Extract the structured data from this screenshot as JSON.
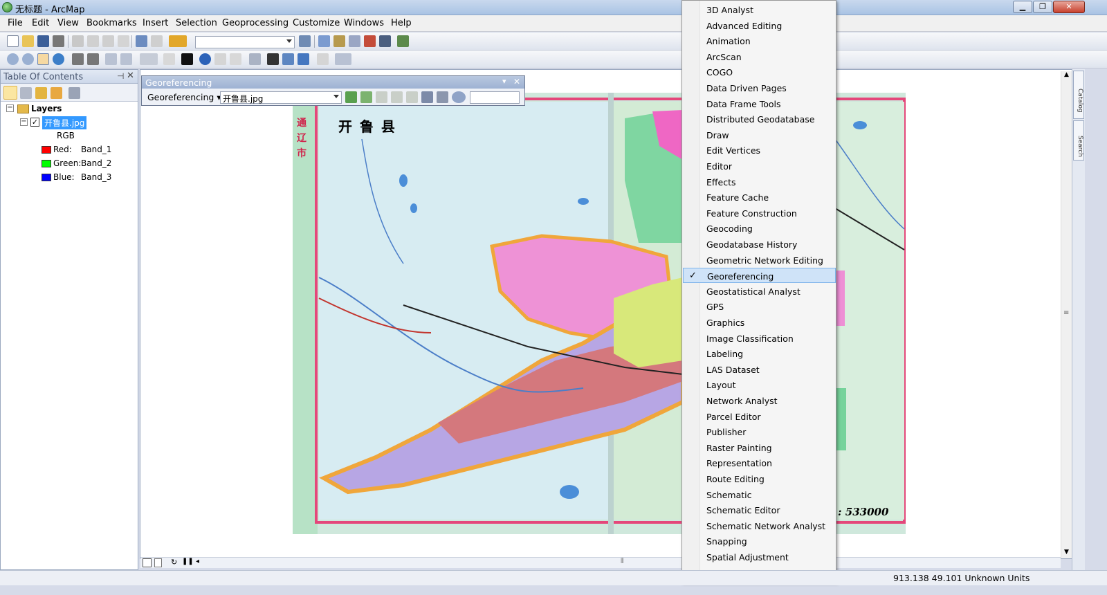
{
  "window": {
    "title": "无标题 - ArcMap"
  },
  "menubar": [
    "File",
    "Edit",
    "View",
    "Bookmarks",
    "Insert",
    "Selection",
    "Geoprocessing",
    "Customize",
    "Windows",
    "Help"
  ],
  "toc": {
    "title": "Table Of Contents",
    "root": "Layers",
    "layer": "开鲁县.jpg",
    "rgb": "RGB",
    "bands": [
      {
        "name": "Red:",
        "band": "Band_1",
        "color": "#ff0000"
      },
      {
        "name": "Green:",
        "band": "Band_2",
        "color": "#00ff00"
      },
      {
        "name": "Blue:",
        "band": "Band_3",
        "color": "#0000ff"
      }
    ]
  },
  "georef": {
    "title": "Georeferencing",
    "menu_label": "Georeferencing",
    "layer_value": "开鲁县.jpg"
  },
  "map": {
    "title_text": "开 鲁 县",
    "scale_text": ": 533000",
    "side_labels": [
      "通",
      "辽",
      "市"
    ]
  },
  "dropdown": {
    "items": [
      "3D Analyst",
      "Advanced Editing",
      "Animation",
      "ArcScan",
      "COGO",
      "Data Driven Pages",
      "Data Frame Tools",
      "Distributed Geodatabase",
      "Draw",
      "Edit Vertices",
      "Editor",
      "Effects",
      "Feature Cache",
      "Feature Construction",
      "Geocoding",
      "Geodatabase History",
      "Geometric Network Editing",
      "Georeferencing",
      "Geostatistical Analyst",
      "GPS",
      "Graphics",
      "Image Classification",
      "Labeling",
      "LAS Dataset",
      "Layout",
      "Network Analyst",
      "Parcel Editor",
      "Publisher",
      "Raster Painting",
      "Representation",
      "Route Editing",
      "Schematic",
      "Schematic Editor",
      "Schematic Network Analyst",
      "Snapping",
      "Spatial Adjustment"
    ],
    "selected": "Georeferencing"
  },
  "statusbar": {
    "coords": "913.138  49.101 Unknown Units"
  },
  "rightdock": {
    "tabs": [
      "Catalog",
      "Search"
    ]
  },
  "icons": {
    "check": "✓",
    "more": "▾",
    "close": "✕",
    "pin": "pin-icon",
    "minimize": "minimize-icon",
    "maximize": "maximize-icon"
  }
}
